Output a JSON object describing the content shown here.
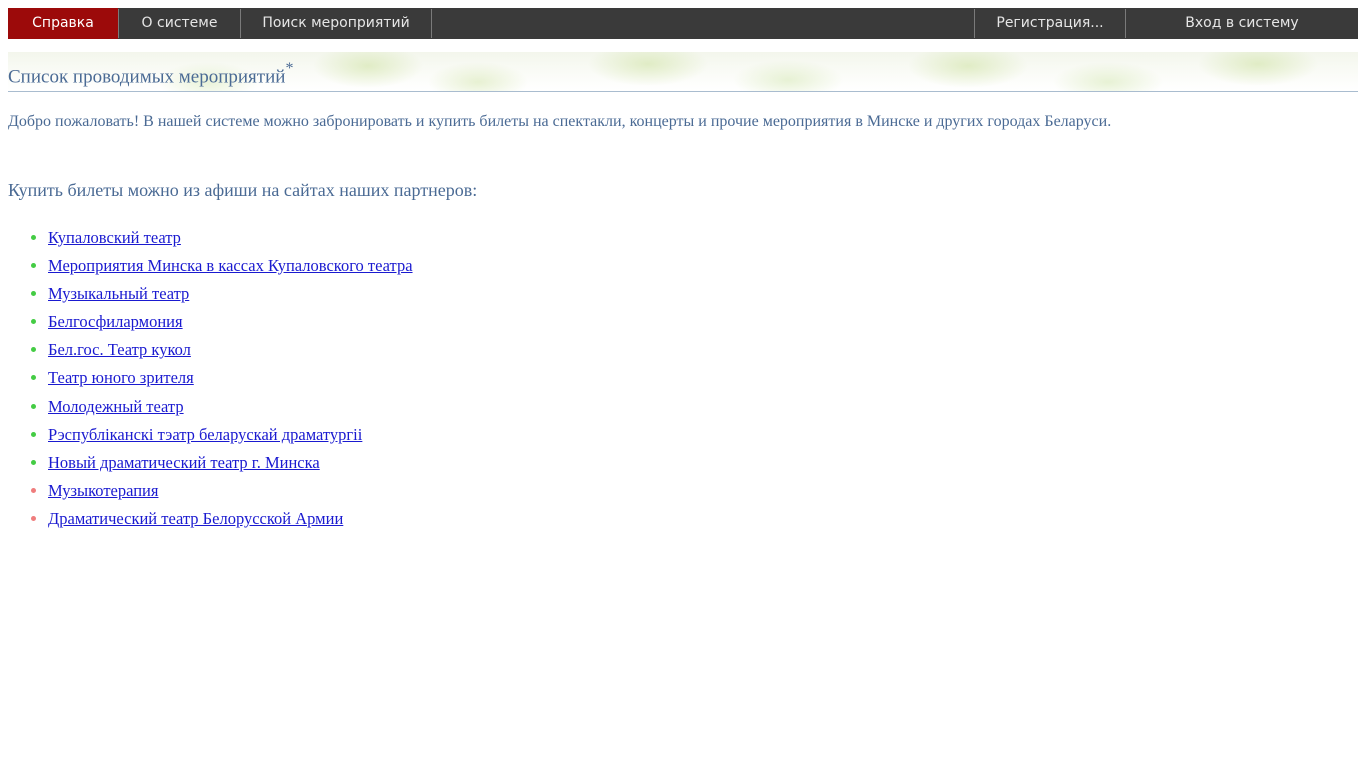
{
  "nav": {
    "help": "Справка",
    "about": "О системе",
    "search": "Поиск мероприятий",
    "register": "Регистрация...",
    "login": "Вход в систему"
  },
  "header": {
    "title": "Список проводимых мероприятий",
    "title_mark": "*"
  },
  "content": {
    "welcome": "Добро пожаловать! В нашей системе можно забронировать и купить билеты на спектакли, концерты и прочие мероприятия в Минске и других городах Беларуси.",
    "buy_text": "Купить билеты можно из афиши на сайтах наших партнеров:"
  },
  "partners": [
    {
      "label": "Купаловский театр",
      "bullet": "green"
    },
    {
      "label": "Мероприятия Минска в кассах Купаловского театра",
      "bullet": "green"
    },
    {
      "label": "Музыкальный театр",
      "bullet": "green"
    },
    {
      "label": "Белгосфилармония",
      "bullet": "green"
    },
    {
      "label": "Бел.гос. Театр кукол",
      "bullet": "green"
    },
    {
      "label": "Театр юного зрителя",
      "bullet": "green"
    },
    {
      "label": "Молодежный театр",
      "bullet": "green"
    },
    {
      "label": "Рэспубліканскі тэатр беларускай драматургіі",
      "bullet": "green"
    },
    {
      "label": "Новый драматический театр г. Минска",
      "bullet": "green"
    },
    {
      "label": "Музыкотерапия",
      "bullet": "red"
    },
    {
      "label": "Драматический театр Белорусской Армии",
      "bullet": "red"
    }
  ],
  "colors": {
    "nav_bg": "#3a3a3a",
    "nav_active": "#9c0a0a",
    "text": "#4a6a94",
    "link": "#1a1ad0",
    "bullet_green": "#44cc44",
    "bullet_red": "#ef7d7d"
  }
}
